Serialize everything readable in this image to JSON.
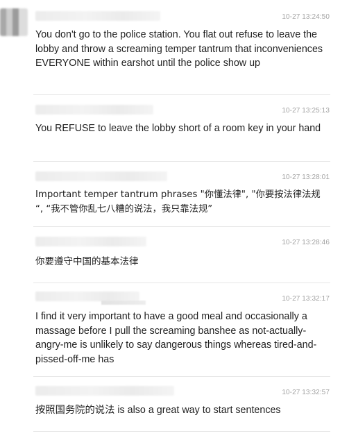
{
  "messages": [
    {
      "time": "10-27 13:24:50",
      "text": "You don't go to the police station. You flat out refuse to leave the lobby and throw a screaming temper tantrum that inconveniences EVERYONE within earshot until the police show up"
    },
    {
      "time": "10-27 13:25:13",
      "text": "You REFUSE to leave the lobby short of a room key in your hand"
    },
    {
      "time": "10-27 13:28:01",
      "text": "Important temper tantrum phrases \"你懂法律\", \"你要按法律法规 “, “我不管你乱七八糟的说法，我只靠法规”"
    },
    {
      "time": "10-27 13:28:46",
      "text": "你要遵守中国的基本法律"
    },
    {
      "time": "10-27 13:32:17",
      "text": "I find it very important to have a good meal and occasionally a massage before I pull the screaming banshee as not-actually-angry-me is unlikely to say dangerous things whereas tired-and-pissed-off-me has"
    },
    {
      "time": "10-27 13:32:57",
      "text": "按照国务院的说法 is also a great way to start sentences"
    }
  ]
}
